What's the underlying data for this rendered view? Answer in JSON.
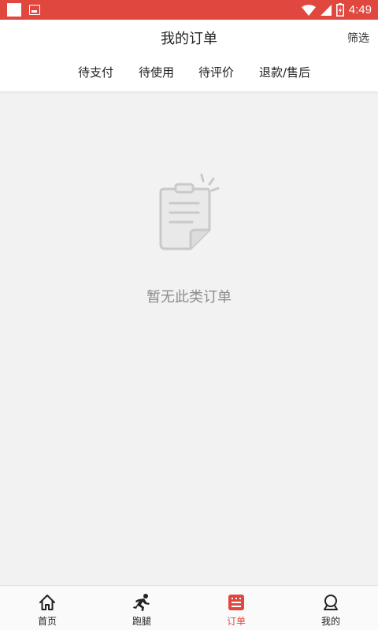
{
  "status_bar": {
    "time": "4:49",
    "background": "#e0473e",
    "icons": [
      "notification-square-icon",
      "image-icon",
      "wifi-icon",
      "signal-icon",
      "battery-charging-icon"
    ]
  },
  "header": {
    "title": "我的订单",
    "filter_label": "筛选"
  },
  "tabs": [
    {
      "label": "待支付"
    },
    {
      "label": "待使用"
    },
    {
      "label": "待评价"
    },
    {
      "label": "退款/售后"
    }
  ],
  "empty_state": {
    "icon": "empty-clipboard-icon",
    "message": "暂无此类订单"
  },
  "bottom_nav": {
    "active_color": "#e0473e",
    "items": [
      {
        "label": "首页",
        "icon": "home-icon"
      },
      {
        "label": "跑腿",
        "icon": "runner-icon"
      },
      {
        "label": "订单",
        "icon": "order-list-icon",
        "active": true
      },
      {
        "label": "我的",
        "icon": "profile-icon"
      }
    ]
  }
}
